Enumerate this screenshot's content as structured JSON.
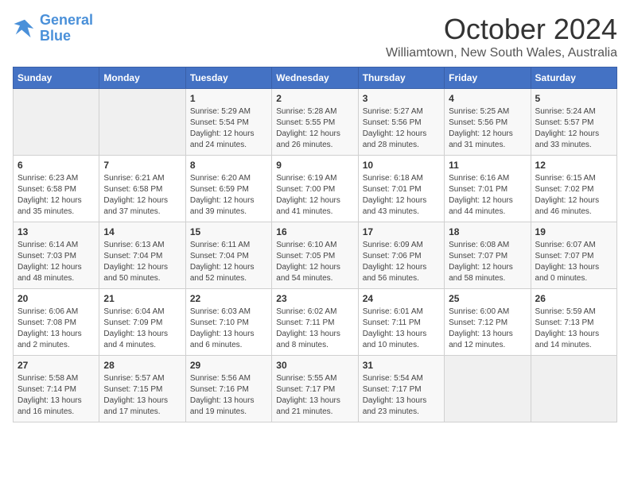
{
  "logo": {
    "line1": "General",
    "line2": "Blue"
  },
  "title": "October 2024",
  "subtitle": "Williamtown, New South Wales, Australia",
  "days_of_week": [
    "Sunday",
    "Monday",
    "Tuesday",
    "Wednesday",
    "Thursday",
    "Friday",
    "Saturday"
  ],
  "weeks": [
    [
      {
        "day": "",
        "info": ""
      },
      {
        "day": "",
        "info": ""
      },
      {
        "day": "1",
        "info": "Sunrise: 5:29 AM\nSunset: 5:54 PM\nDaylight: 12 hours\nand 24 minutes."
      },
      {
        "day": "2",
        "info": "Sunrise: 5:28 AM\nSunset: 5:55 PM\nDaylight: 12 hours\nand 26 minutes."
      },
      {
        "day": "3",
        "info": "Sunrise: 5:27 AM\nSunset: 5:56 PM\nDaylight: 12 hours\nand 28 minutes."
      },
      {
        "day": "4",
        "info": "Sunrise: 5:25 AM\nSunset: 5:56 PM\nDaylight: 12 hours\nand 31 minutes."
      },
      {
        "day": "5",
        "info": "Sunrise: 5:24 AM\nSunset: 5:57 PM\nDaylight: 12 hours\nand 33 minutes."
      }
    ],
    [
      {
        "day": "6",
        "info": "Sunrise: 6:23 AM\nSunset: 6:58 PM\nDaylight: 12 hours\nand 35 minutes."
      },
      {
        "day": "7",
        "info": "Sunrise: 6:21 AM\nSunset: 6:58 PM\nDaylight: 12 hours\nand 37 minutes."
      },
      {
        "day": "8",
        "info": "Sunrise: 6:20 AM\nSunset: 6:59 PM\nDaylight: 12 hours\nand 39 minutes."
      },
      {
        "day": "9",
        "info": "Sunrise: 6:19 AM\nSunset: 7:00 PM\nDaylight: 12 hours\nand 41 minutes."
      },
      {
        "day": "10",
        "info": "Sunrise: 6:18 AM\nSunset: 7:01 PM\nDaylight: 12 hours\nand 43 minutes."
      },
      {
        "day": "11",
        "info": "Sunrise: 6:16 AM\nSunset: 7:01 PM\nDaylight: 12 hours\nand 44 minutes."
      },
      {
        "day": "12",
        "info": "Sunrise: 6:15 AM\nSunset: 7:02 PM\nDaylight: 12 hours\nand 46 minutes."
      }
    ],
    [
      {
        "day": "13",
        "info": "Sunrise: 6:14 AM\nSunset: 7:03 PM\nDaylight: 12 hours\nand 48 minutes."
      },
      {
        "day": "14",
        "info": "Sunrise: 6:13 AM\nSunset: 7:04 PM\nDaylight: 12 hours\nand 50 minutes."
      },
      {
        "day": "15",
        "info": "Sunrise: 6:11 AM\nSunset: 7:04 PM\nDaylight: 12 hours\nand 52 minutes."
      },
      {
        "day": "16",
        "info": "Sunrise: 6:10 AM\nSunset: 7:05 PM\nDaylight: 12 hours\nand 54 minutes."
      },
      {
        "day": "17",
        "info": "Sunrise: 6:09 AM\nSunset: 7:06 PM\nDaylight: 12 hours\nand 56 minutes."
      },
      {
        "day": "18",
        "info": "Sunrise: 6:08 AM\nSunset: 7:07 PM\nDaylight: 12 hours\nand 58 minutes."
      },
      {
        "day": "19",
        "info": "Sunrise: 6:07 AM\nSunset: 7:07 PM\nDaylight: 13 hours\nand 0 minutes."
      }
    ],
    [
      {
        "day": "20",
        "info": "Sunrise: 6:06 AM\nSunset: 7:08 PM\nDaylight: 13 hours\nand 2 minutes."
      },
      {
        "day": "21",
        "info": "Sunrise: 6:04 AM\nSunset: 7:09 PM\nDaylight: 13 hours\nand 4 minutes."
      },
      {
        "day": "22",
        "info": "Sunrise: 6:03 AM\nSunset: 7:10 PM\nDaylight: 13 hours\nand 6 minutes."
      },
      {
        "day": "23",
        "info": "Sunrise: 6:02 AM\nSunset: 7:11 PM\nDaylight: 13 hours\nand 8 minutes."
      },
      {
        "day": "24",
        "info": "Sunrise: 6:01 AM\nSunset: 7:11 PM\nDaylight: 13 hours\nand 10 minutes."
      },
      {
        "day": "25",
        "info": "Sunrise: 6:00 AM\nSunset: 7:12 PM\nDaylight: 13 hours\nand 12 minutes."
      },
      {
        "day": "26",
        "info": "Sunrise: 5:59 AM\nSunset: 7:13 PM\nDaylight: 13 hours\nand 14 minutes."
      }
    ],
    [
      {
        "day": "27",
        "info": "Sunrise: 5:58 AM\nSunset: 7:14 PM\nDaylight: 13 hours\nand 16 minutes."
      },
      {
        "day": "28",
        "info": "Sunrise: 5:57 AM\nSunset: 7:15 PM\nDaylight: 13 hours\nand 17 minutes."
      },
      {
        "day": "29",
        "info": "Sunrise: 5:56 AM\nSunset: 7:16 PM\nDaylight: 13 hours\nand 19 minutes."
      },
      {
        "day": "30",
        "info": "Sunrise: 5:55 AM\nSunset: 7:17 PM\nDaylight: 13 hours\nand 21 minutes."
      },
      {
        "day": "31",
        "info": "Sunrise: 5:54 AM\nSunset: 7:17 PM\nDaylight: 13 hours\nand 23 minutes."
      },
      {
        "day": "",
        "info": ""
      },
      {
        "day": "",
        "info": ""
      }
    ]
  ]
}
